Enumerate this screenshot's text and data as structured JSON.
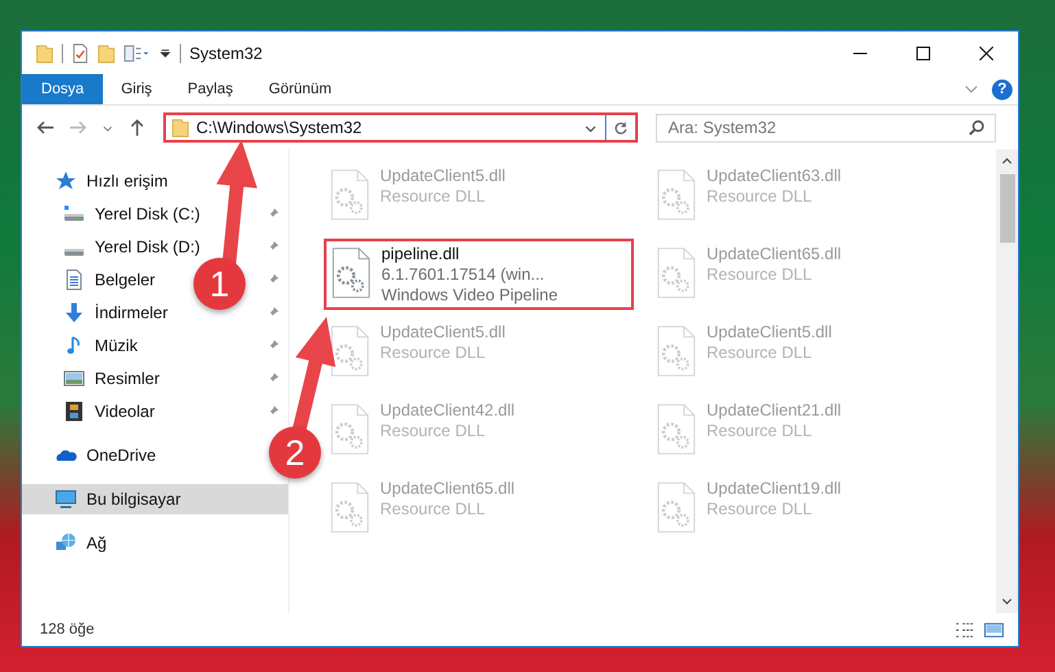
{
  "window": {
    "title": "System32"
  },
  "ribbon": {
    "tabs": [
      {
        "label": "Dosya",
        "selected": true
      },
      {
        "label": "Giriş",
        "selected": false
      },
      {
        "label": "Paylaş",
        "selected": false
      },
      {
        "label": "Görünüm",
        "selected": false
      }
    ],
    "help_label": "?"
  },
  "address_bar": {
    "path": "C:\\Windows\\System32",
    "highlighted": true
  },
  "search": {
    "placeholder": "Ara: System32"
  },
  "sidebar": {
    "items": [
      {
        "label": "Hızlı erişim",
        "kind": "quick-access",
        "selected": false,
        "children": [
          {
            "label": "Yerel Disk (C:)",
            "kind": "system-drive",
            "selected": false,
            "pinned": true
          },
          {
            "label": "Yerel Disk (D:)",
            "kind": "drive",
            "selected": false,
            "pinned": true
          },
          {
            "label": "Belgeler",
            "kind": "documents",
            "selected": false,
            "pinned": true
          },
          {
            "label": "İndirmeler",
            "kind": "downloads",
            "selected": false,
            "pinned": true
          },
          {
            "label": "Müzik",
            "kind": "music",
            "selected": false,
            "pinned": true
          },
          {
            "label": "Resimler",
            "kind": "pictures",
            "selected": false,
            "pinned": true
          },
          {
            "label": "Videolar",
            "kind": "videos",
            "selected": false,
            "pinned": true
          }
        ]
      },
      {
        "label": "OneDrive",
        "kind": "onedrive",
        "selected": false
      },
      {
        "label": "Bu bilgisayar",
        "kind": "computer",
        "selected": true
      },
      {
        "label": "Ağ",
        "kind": "network",
        "selected": false
      }
    ]
  },
  "files": [
    {
      "name": "UpdateClient5.dll",
      "lines": [
        "Resource DLL"
      ],
      "blurred": true,
      "highlighted": false
    },
    {
      "name": "UpdateClient63.dll",
      "lines": [
        "Resource DLL"
      ],
      "blurred": true,
      "highlighted": false
    },
    {
      "name": "pipeline.dll",
      "lines": [
        "6.1.7601.17514 (win...",
        "Windows Video Pipeline"
      ],
      "blurred": false,
      "highlighted": true
    },
    {
      "name": "UpdateClient65.dll",
      "lines": [
        "Resource DLL"
      ],
      "blurred": true,
      "highlighted": false
    },
    {
      "name": "UpdateClient5.dll",
      "lines": [
        "Resource DLL"
      ],
      "blurred": true,
      "highlighted": false
    },
    {
      "name": "UpdateClient5.dll",
      "lines": [
        "Resource DLL"
      ],
      "blurred": true,
      "highlighted": false
    },
    {
      "name": "UpdateClient42.dll",
      "lines": [
        "Resource DLL"
      ],
      "blurred": true,
      "highlighted": false
    },
    {
      "name": "UpdateClient21.dll",
      "lines": [
        "Resource DLL"
      ],
      "blurred": true,
      "highlighted": false
    },
    {
      "name": "UpdateClient65.dll",
      "lines": [
        "Resource DLL"
      ],
      "blurred": true,
      "highlighted": false
    },
    {
      "name": "UpdateClient19.dll",
      "lines": [
        "Resource DLL"
      ],
      "blurred": true,
      "highlighted": false
    }
  ],
  "status_bar": {
    "item_count": "128 öğe"
  },
  "annotations": [
    {
      "number": "1"
    },
    {
      "number": "2"
    }
  ]
}
